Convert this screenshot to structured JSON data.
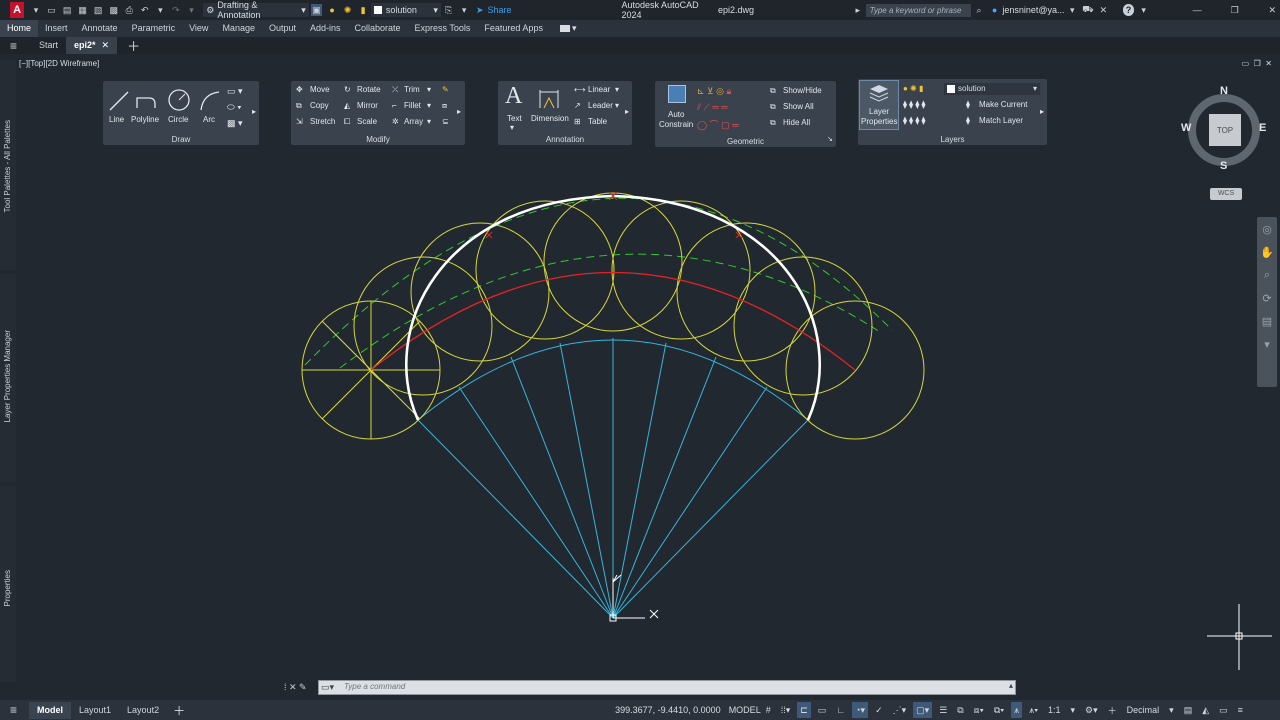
{
  "titlebar": {
    "app_logo": "A",
    "workspace": "Drafting & Annotation",
    "layer_combo": "solution",
    "share": "Share",
    "title": "Autodesk AutoCAD 2024",
    "filename": "epi2.dwg",
    "search_placeholder": "Type a keyword or phrase",
    "user": "jensninet@ya...",
    "help": "?"
  },
  "ribbon_tabs": [
    "Home",
    "Insert",
    "Annotate",
    "Parametric",
    "View",
    "Manage",
    "Output",
    "Add-ins",
    "Collaborate",
    "Express Tools",
    "Featured Apps"
  ],
  "doc_tabs": {
    "start": "Start",
    "current": "epi2*"
  },
  "viewport_label": "[−][Top][2D Wireframe]",
  "panels": {
    "draw": {
      "title": "Draw",
      "tools": [
        "Line",
        "Polyline",
        "Circle",
        "Arc"
      ]
    },
    "modify": {
      "title": "Modify",
      "items": [
        "Move",
        "Rotate",
        "Trim",
        "Copy",
        "Mirror",
        "Fillet",
        "Stretch",
        "Scale",
        "Array"
      ]
    },
    "annotation": {
      "title": "Annotation",
      "text": "Text",
      "dimension": "Dimension",
      "linear": "Linear",
      "leader": "Leader",
      "table": "Table"
    },
    "geometric": {
      "title": "Geometric",
      "auto": "Auto",
      "constrain": "Constrain",
      "show_hide": "Show/Hide",
      "show_all": "Show All",
      "hide_all": "Hide All"
    },
    "layers": {
      "title": "Layers",
      "props1": "Layer",
      "props2": "Properties",
      "current_layer": "solution",
      "make_current": "Make Current",
      "match_layer": "Match Layer"
    }
  },
  "viewcube": {
    "n": "N",
    "s": "S",
    "e": "E",
    "w": "W",
    "top": "TOP",
    "wcs": "WCS"
  },
  "side_palettes": [
    "Tool Palettes - All Palettes",
    "Layer Properties Manager",
    "Properties"
  ],
  "command_placeholder": "Type a command",
  "status": {
    "model_tab": "Model",
    "layout1": "Layout1",
    "layout2": "Layout2",
    "coords": "399.3677, -9.4410, 0.0000",
    "model": "MODEL",
    "scale": "1:1",
    "units": "Decimal"
  },
  "drawing": {
    "colors": {
      "yellow": "#d8d83a",
      "green": "#32c832",
      "red": "#e02424",
      "cyan": "#35b6dc",
      "white": "#ffffff"
    }
  }
}
